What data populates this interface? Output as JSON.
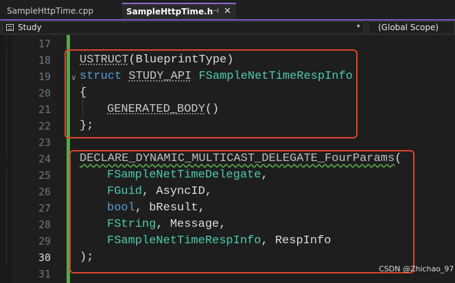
{
  "tabs": [
    {
      "label": "SampleHttpTime.cpp",
      "active": false
    },
    {
      "label": "SampleHttpTime.h",
      "active": true
    }
  ],
  "tab_icons": {
    "pin": "pin-icon",
    "close": "close-icon"
  },
  "nav": {
    "project": "Study",
    "scope": "(Global Scope)"
  },
  "editor": {
    "line_numbers": [
      "17",
      "18",
      "19",
      "20",
      "21",
      "22",
      "23",
      "24",
      "25",
      "26",
      "27",
      "28",
      "29",
      "30",
      "31"
    ],
    "current_line": "30",
    "lines": {
      "l18": {
        "kw": "USTRUCT",
        "rest": "(BlueprintType)"
      },
      "l19": {
        "kw": "struct",
        "api": "STUDY_API",
        "name": "FSampleNetTimeRespInfo"
      },
      "l20": "{",
      "l21": {
        "kw": "GENERATED_BODY",
        "rest": "()"
      },
      "l22": "};",
      "l24": {
        "kw": "DECLARE_DYNAMIC_MULTICAST_DELEGATE_FourParams",
        "rest": "("
      },
      "l25": {
        "type": "FSampleNetTimeDelegate",
        "rest": ","
      },
      "l26": {
        "type": "FGuid",
        "rest": ", AsyncID,"
      },
      "l27": {
        "type": "bool",
        "rest": ", bResult,"
      },
      "l28": {
        "type": "FString",
        "rest": ", Message,"
      },
      "l29": {
        "type": "FSampleNetTimeRespInfo",
        "rest": ", RespInfo"
      },
      "l30": ");"
    }
  },
  "watermark": "CSDN @Zhichao_97",
  "colors": {
    "keyword": "#569cd6",
    "type": "#4ec9b0",
    "highlight_box": "#e0452b",
    "change_bar": "#57a64a",
    "tab_accent": "#7a5cc4"
  }
}
